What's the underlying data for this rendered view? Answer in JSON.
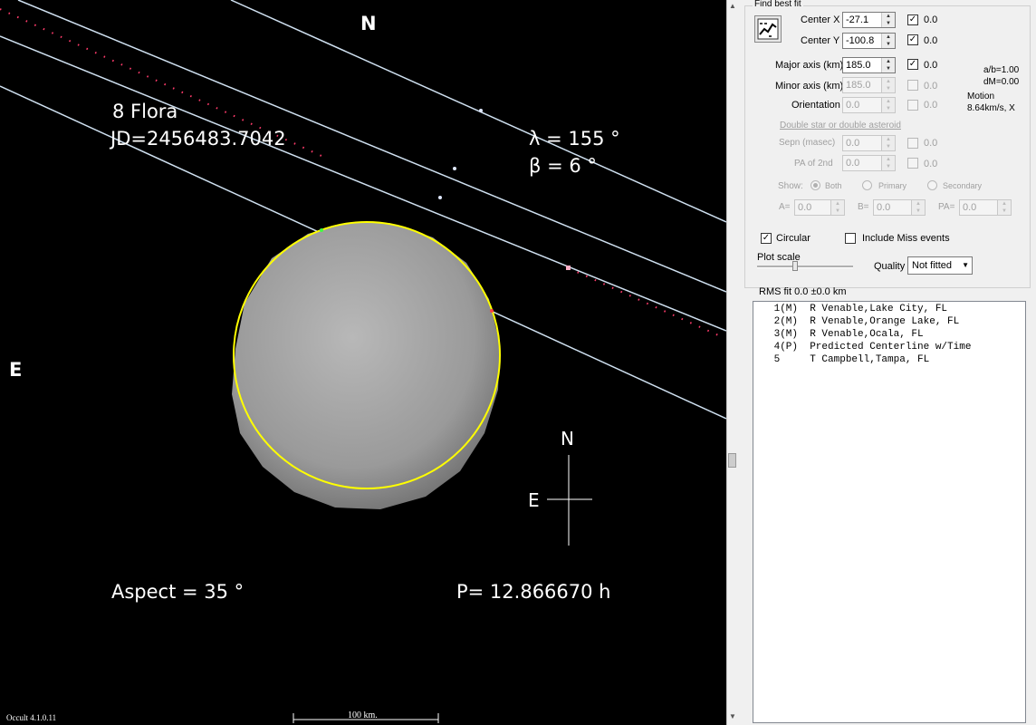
{
  "plot": {
    "direction_top": "N",
    "direction_left": "E",
    "object_name": "8 Flora",
    "jd": "JD=2456483.7042",
    "lambda": "λ =  155 °",
    "beta": "β =    6 °",
    "aspect": "Aspect = 35 °",
    "period": "P= 12.866670 h",
    "compass_n": "N",
    "compass_e": "E",
    "version": "Occult 4.1.0.11",
    "scale_bar_label": "100 km.",
    "colors": {
      "background": "#000000",
      "chord": "#cfe0f0",
      "ellipse": "#ffff00",
      "predicted": "#ff3b6b",
      "body": "#9a9a9a"
    }
  },
  "panel": {
    "find_best_fit": "Find best fit",
    "center_x": {
      "label": "Center X",
      "value": "-27.1",
      "checked": true,
      "fit": "0.0"
    },
    "center_y": {
      "label": "Center Y",
      "value": "-100.8",
      "checked": true,
      "fit": "0.0"
    },
    "major_axis": {
      "label": "Major axis (km)",
      "value": "185.0",
      "checked": true,
      "fit": "0.0"
    },
    "minor_axis": {
      "label": "Minor axis (km)",
      "value": "185.0",
      "checked": false,
      "fit": "0.0"
    },
    "orientation": {
      "label": "Orientation",
      "value": "0.0",
      "checked": false,
      "fit": "0.0"
    },
    "ab_ratio": "a/b=1.00",
    "dm": "dM=0.00",
    "motion_label": "Motion",
    "motion_value": "8.64km/s, X",
    "double_star": "Double star  or  double asteroid",
    "sepn": {
      "label": "Sepn (masec)",
      "value": "0.0",
      "fit": "0.0"
    },
    "pa2": {
      "label": "PA of 2nd",
      "value": "0.0",
      "fit": "0.0"
    },
    "show_label": "Show:",
    "show_options": [
      "Both",
      "Primary",
      "Secondary"
    ],
    "a_label": "A=",
    "a_value": "0.0",
    "b_label": "B=",
    "b_value": "0.0",
    "pa_label": "PA=",
    "pa_value": "0.0",
    "circular_label": "Circular",
    "circular_checked": true,
    "include_miss_label": "Include Miss events",
    "include_miss_checked": false,
    "plot_scale_label": "Plot scale",
    "quality_label": "Quality",
    "quality_value": "Not fitted",
    "rms_fit": "RMS fit  0.0 ±0.0 km",
    "events": [
      " 1(M)  R Venable,Lake City, FL",
      " 2(M)  R Venable,Orange Lake, FL",
      " 3(M)  R Venable,Ocala, FL",
      " 4(P)  Predicted Centerline w/Time",
      " 5     T Campbell,Tampa, FL"
    ]
  }
}
